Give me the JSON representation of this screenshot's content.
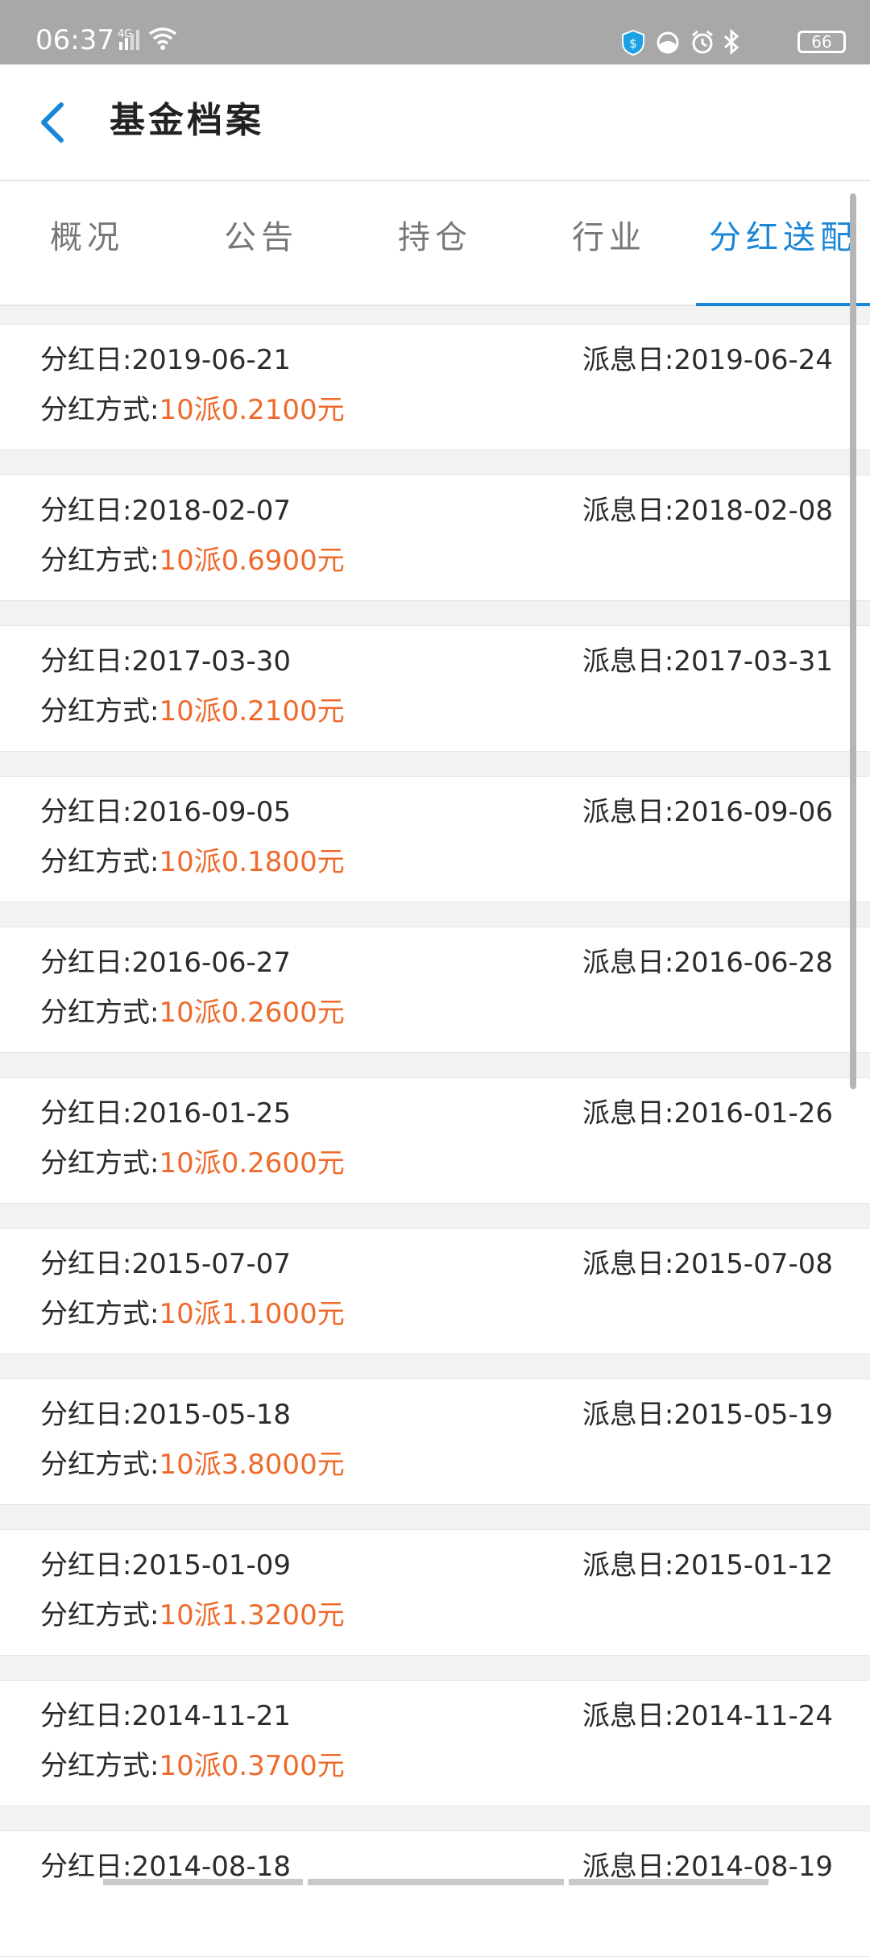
{
  "status_bar": {
    "time": "06:37",
    "network": "4G",
    "battery": "66",
    "icons": [
      "signal-icon",
      "wifi-icon",
      "shield-icon",
      "toggle-icon",
      "alarm-icon",
      "bluetooth-icon"
    ]
  },
  "header": {
    "title": "基金档案",
    "back_icon": "chevron-left-icon"
  },
  "tabs": [
    {
      "label": "概况",
      "active": false
    },
    {
      "label": "公告",
      "active": false
    },
    {
      "label": "持仓",
      "active": false
    },
    {
      "label": "行业",
      "active": false
    },
    {
      "label": "分红送配",
      "active": true
    }
  ],
  "labels": {
    "dividend_date": "分红日:",
    "payout_date": "派息日:",
    "method": "分红方式:"
  },
  "dividends": [
    {
      "dividend_date": "2019-06-21",
      "payout_date": "2019-06-24",
      "method": "10派0.2100元"
    },
    {
      "dividend_date": "2018-02-07",
      "payout_date": "2018-02-08",
      "method": "10派0.6900元"
    },
    {
      "dividend_date": "2017-03-30",
      "payout_date": "2017-03-31",
      "method": "10派0.2100元"
    },
    {
      "dividend_date": "2016-09-05",
      "payout_date": "2016-09-06",
      "method": "10派0.1800元"
    },
    {
      "dividend_date": "2016-06-27",
      "payout_date": "2016-06-28",
      "method": "10派0.2600元"
    },
    {
      "dividend_date": "2016-01-25",
      "payout_date": "2016-01-26",
      "method": "10派0.2600元"
    },
    {
      "dividend_date": "2015-07-07",
      "payout_date": "2015-07-08",
      "method": "10派1.1000元"
    },
    {
      "dividend_date": "2015-05-18",
      "payout_date": "2015-05-19",
      "method": "10派3.8000元"
    },
    {
      "dividend_date": "2015-01-09",
      "payout_date": "2015-01-12",
      "method": "10派1.3200元"
    },
    {
      "dividend_date": "2014-11-21",
      "payout_date": "2014-11-24",
      "method": "10派0.3700元"
    },
    {
      "dividend_date": "2014-08-18",
      "payout_date": "2014-08-19",
      "method": ""
    }
  ],
  "colors": {
    "accent": "#1a86d6",
    "amount": "#ee6a2c",
    "status_bar": "#a8a8a8",
    "background": "#f2f2f2"
  }
}
